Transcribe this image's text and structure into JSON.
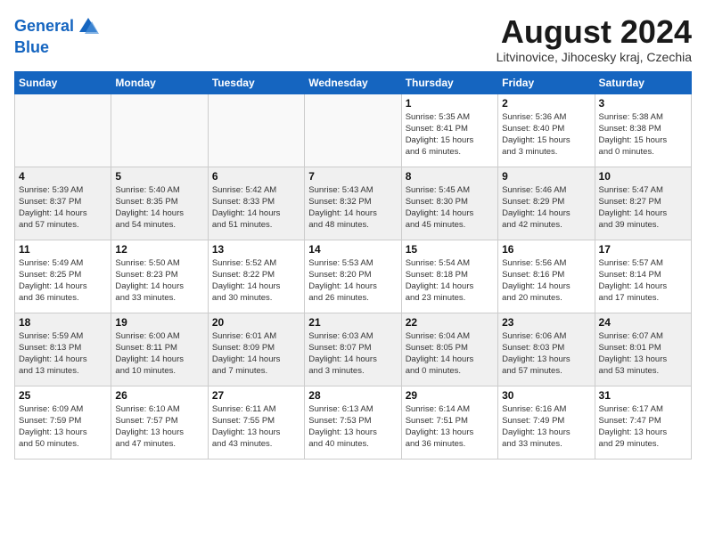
{
  "header": {
    "logo_line1": "General",
    "logo_line2": "Blue",
    "month": "August 2024",
    "location": "Litvinovice, Jihocesky kraj, Czechia"
  },
  "days_of_week": [
    "Sunday",
    "Monday",
    "Tuesday",
    "Wednesday",
    "Thursday",
    "Friday",
    "Saturday"
  ],
  "weeks": [
    [
      {
        "day": "",
        "info": ""
      },
      {
        "day": "",
        "info": ""
      },
      {
        "day": "",
        "info": ""
      },
      {
        "day": "",
        "info": ""
      },
      {
        "day": "1",
        "info": "Sunrise: 5:35 AM\nSunset: 8:41 PM\nDaylight: 15 hours\nand 6 minutes."
      },
      {
        "day": "2",
        "info": "Sunrise: 5:36 AM\nSunset: 8:40 PM\nDaylight: 15 hours\nand 3 minutes."
      },
      {
        "day": "3",
        "info": "Sunrise: 5:38 AM\nSunset: 8:38 PM\nDaylight: 15 hours\nand 0 minutes."
      }
    ],
    [
      {
        "day": "4",
        "info": "Sunrise: 5:39 AM\nSunset: 8:37 PM\nDaylight: 14 hours\nand 57 minutes."
      },
      {
        "day": "5",
        "info": "Sunrise: 5:40 AM\nSunset: 8:35 PM\nDaylight: 14 hours\nand 54 minutes."
      },
      {
        "day": "6",
        "info": "Sunrise: 5:42 AM\nSunset: 8:33 PM\nDaylight: 14 hours\nand 51 minutes."
      },
      {
        "day": "7",
        "info": "Sunrise: 5:43 AM\nSunset: 8:32 PM\nDaylight: 14 hours\nand 48 minutes."
      },
      {
        "day": "8",
        "info": "Sunrise: 5:45 AM\nSunset: 8:30 PM\nDaylight: 14 hours\nand 45 minutes."
      },
      {
        "day": "9",
        "info": "Sunrise: 5:46 AM\nSunset: 8:29 PM\nDaylight: 14 hours\nand 42 minutes."
      },
      {
        "day": "10",
        "info": "Sunrise: 5:47 AM\nSunset: 8:27 PM\nDaylight: 14 hours\nand 39 minutes."
      }
    ],
    [
      {
        "day": "11",
        "info": "Sunrise: 5:49 AM\nSunset: 8:25 PM\nDaylight: 14 hours\nand 36 minutes."
      },
      {
        "day": "12",
        "info": "Sunrise: 5:50 AM\nSunset: 8:23 PM\nDaylight: 14 hours\nand 33 minutes."
      },
      {
        "day": "13",
        "info": "Sunrise: 5:52 AM\nSunset: 8:22 PM\nDaylight: 14 hours\nand 30 minutes."
      },
      {
        "day": "14",
        "info": "Sunrise: 5:53 AM\nSunset: 8:20 PM\nDaylight: 14 hours\nand 26 minutes."
      },
      {
        "day": "15",
        "info": "Sunrise: 5:54 AM\nSunset: 8:18 PM\nDaylight: 14 hours\nand 23 minutes."
      },
      {
        "day": "16",
        "info": "Sunrise: 5:56 AM\nSunset: 8:16 PM\nDaylight: 14 hours\nand 20 minutes."
      },
      {
        "day": "17",
        "info": "Sunrise: 5:57 AM\nSunset: 8:14 PM\nDaylight: 14 hours\nand 17 minutes."
      }
    ],
    [
      {
        "day": "18",
        "info": "Sunrise: 5:59 AM\nSunset: 8:13 PM\nDaylight: 14 hours\nand 13 minutes."
      },
      {
        "day": "19",
        "info": "Sunrise: 6:00 AM\nSunset: 8:11 PM\nDaylight: 14 hours\nand 10 minutes."
      },
      {
        "day": "20",
        "info": "Sunrise: 6:01 AM\nSunset: 8:09 PM\nDaylight: 14 hours\nand 7 minutes."
      },
      {
        "day": "21",
        "info": "Sunrise: 6:03 AM\nSunset: 8:07 PM\nDaylight: 14 hours\nand 3 minutes."
      },
      {
        "day": "22",
        "info": "Sunrise: 6:04 AM\nSunset: 8:05 PM\nDaylight: 14 hours\nand 0 minutes."
      },
      {
        "day": "23",
        "info": "Sunrise: 6:06 AM\nSunset: 8:03 PM\nDaylight: 13 hours\nand 57 minutes."
      },
      {
        "day": "24",
        "info": "Sunrise: 6:07 AM\nSunset: 8:01 PM\nDaylight: 13 hours\nand 53 minutes."
      }
    ],
    [
      {
        "day": "25",
        "info": "Sunrise: 6:09 AM\nSunset: 7:59 PM\nDaylight: 13 hours\nand 50 minutes."
      },
      {
        "day": "26",
        "info": "Sunrise: 6:10 AM\nSunset: 7:57 PM\nDaylight: 13 hours\nand 47 minutes."
      },
      {
        "day": "27",
        "info": "Sunrise: 6:11 AM\nSunset: 7:55 PM\nDaylight: 13 hours\nand 43 minutes."
      },
      {
        "day": "28",
        "info": "Sunrise: 6:13 AM\nSunset: 7:53 PM\nDaylight: 13 hours\nand 40 minutes."
      },
      {
        "day": "29",
        "info": "Sunrise: 6:14 AM\nSunset: 7:51 PM\nDaylight: 13 hours\nand 36 minutes."
      },
      {
        "day": "30",
        "info": "Sunrise: 6:16 AM\nSunset: 7:49 PM\nDaylight: 13 hours\nand 33 minutes."
      },
      {
        "day": "31",
        "info": "Sunrise: 6:17 AM\nSunset: 7:47 PM\nDaylight: 13 hours\nand 29 minutes."
      }
    ]
  ]
}
